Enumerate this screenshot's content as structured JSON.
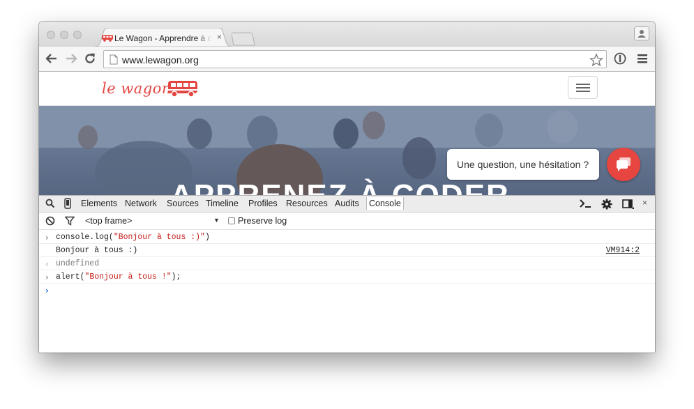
{
  "browser": {
    "tab": {
      "title": "Le Wagon - Apprendre à coder",
      "close_label": "×"
    },
    "url": "www.lewagon.org"
  },
  "site": {
    "logo_text": "le wagon",
    "hero_title": "APPRENEZ À CODER",
    "chat_prompt": "Une question, une hésitation ?"
  },
  "devtools": {
    "tabs": [
      {
        "label": "Elements",
        "active": false
      },
      {
        "label": "Network",
        "active": false
      },
      {
        "label": "Sources",
        "active": false
      },
      {
        "label": "Timeline",
        "active": false
      },
      {
        "label": "Profiles",
        "active": false
      },
      {
        "label": "Resources",
        "active": false
      },
      {
        "label": "Audits",
        "active": false
      },
      {
        "label": "Console",
        "active": true
      }
    ],
    "close_label": "×",
    "filter": {
      "frame": "<top frame>",
      "preserve_log_label": "Preserve log",
      "preserve_log_checked": false
    },
    "console": {
      "line1": {
        "fn": "console.log(",
        "arg": "\"Bonjour à tous :)\"",
        "end": ")"
      },
      "line2": {
        "text": "Bonjour à tous :)",
        "source": "VM914:2"
      },
      "line3": {
        "text": "undefined"
      },
      "line4": {
        "fn": "alert(",
        "arg": "\"Bonjour à tous !\"",
        "end": ");"
      }
    }
  },
  "colors": {
    "brand": "#e44642",
    "chat_button": "#e6463f",
    "string": "#c41a16"
  }
}
